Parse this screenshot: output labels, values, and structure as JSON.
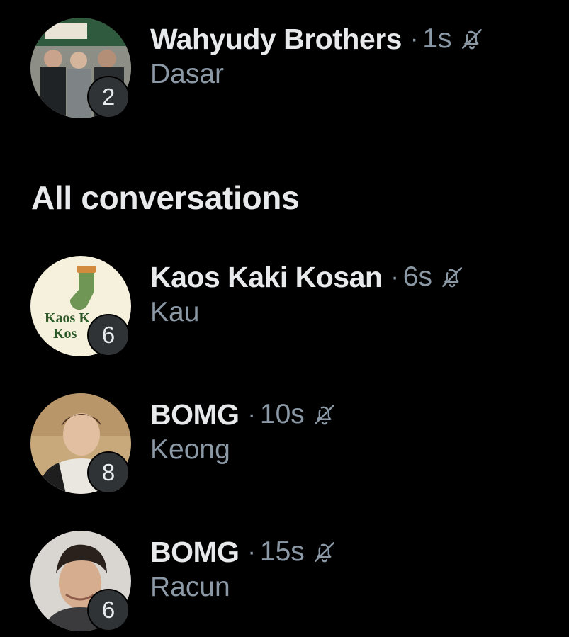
{
  "section_title": "All conversations",
  "pinned": [
    {
      "name": "Wahyudy Brothers",
      "separator": "·",
      "time": "1s",
      "muted_icon": "bell-off-icon",
      "preview": "Dasar",
      "unread_count": "2"
    }
  ],
  "conversations": [
    {
      "name": "Kaos Kaki Kosan",
      "separator": "·",
      "time": "6s",
      "muted_icon": "bell-off-icon",
      "preview": "Kau",
      "unread_count": "6",
      "avatar_text_line1": "Kaos K",
      "avatar_text_line2": "Kos"
    },
    {
      "name": "BOMG",
      "separator": "·",
      "time": "10s",
      "muted_icon": "bell-off-icon",
      "preview": "Keong",
      "unread_count": "8"
    },
    {
      "name": "BOMG",
      "separator": "·",
      "time": "15s",
      "muted_icon": "bell-off-icon",
      "preview": "Racun",
      "unread_count": "6"
    }
  ],
  "colors": {
    "background": "#000000",
    "primary_text": "#e7e9ea",
    "secondary_text": "#8b98a5",
    "badge_background": "#2f3336"
  }
}
